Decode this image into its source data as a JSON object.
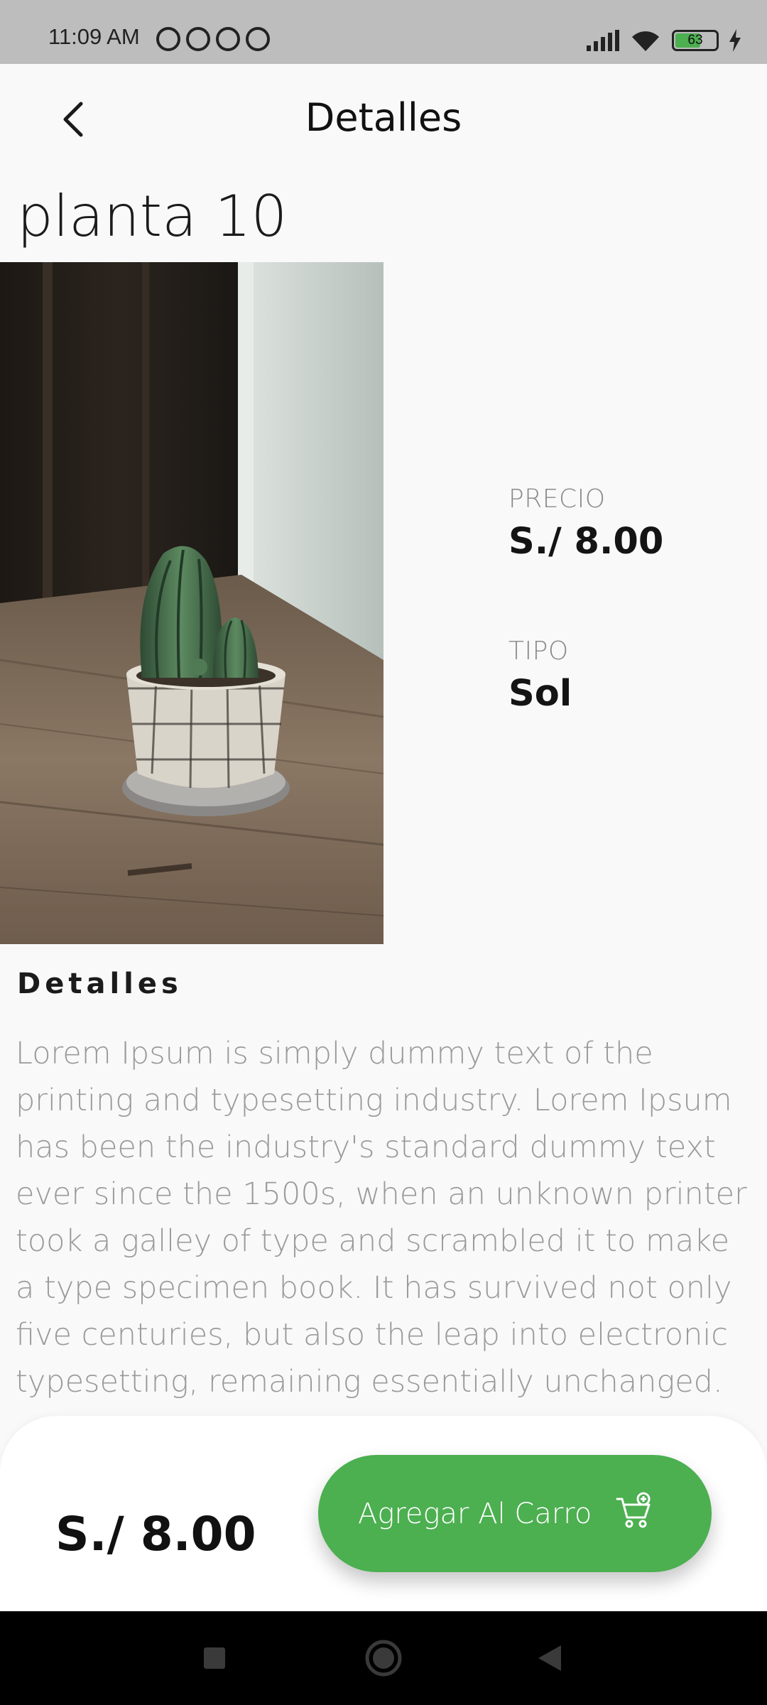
{
  "status_bar": {
    "time": "11:09 AM",
    "battery": "63",
    "icons": [
      "alarm-icon",
      "whatsapp-icon",
      "app-icon",
      "app-icon",
      "signal-icon",
      "wifi-icon",
      "battery-icon",
      "charging-icon"
    ]
  },
  "app_bar": {
    "title": "Detalles",
    "back_icon": "chevron-left-icon"
  },
  "product": {
    "name": "planta 10",
    "image": "cactus-in-pot-photo",
    "price_label": "PRECIO",
    "price_value": "S./ 8.00",
    "type_label": "TIPO",
    "type_value": "Sol"
  },
  "details": {
    "heading": "Detalles",
    "text": "Lorem Ipsum is simply dummy text of the printing and typesetting industry. Lorem Ipsum has been the industry's standard dummy text ever since the 1500s, when an unknown printer took a galley of type and scrambled it to make a type specimen book. It has survived not only five centuries, but also the leap into electronic typesetting, remaining essentially unchanged."
  },
  "bottom": {
    "price": "S./ 8.00",
    "add_button_label": "Agregar Al Carro",
    "cart_icon": "cart-plus-icon"
  },
  "colors": {
    "accent": "#4caf50",
    "background": "#f9f9f9",
    "status_bar": "#bdbdbd",
    "nav_bar": "#000000"
  },
  "nav_bar": {
    "icons": [
      "recents-square-icon",
      "home-circle-icon",
      "back-triangle-icon"
    ]
  }
}
